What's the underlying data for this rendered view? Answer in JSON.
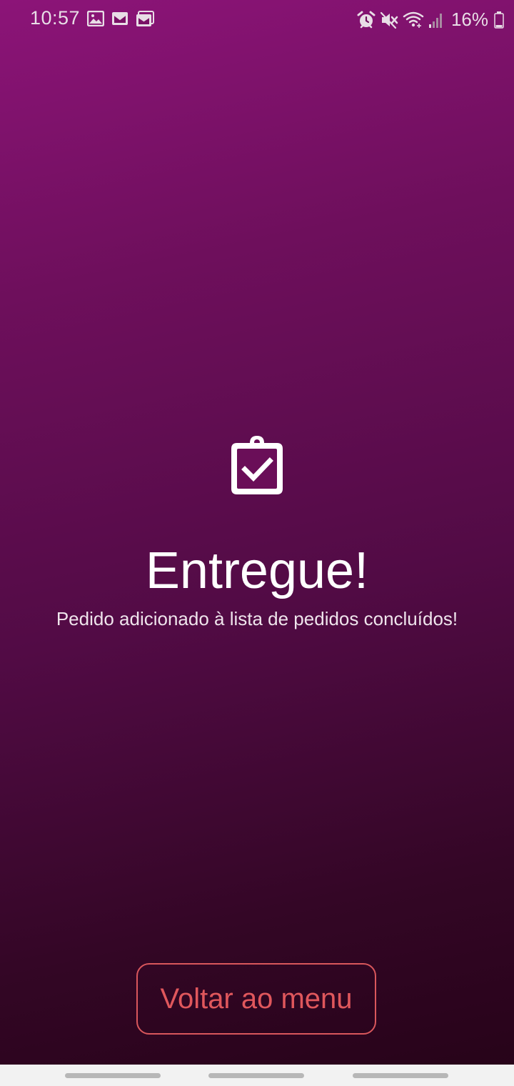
{
  "status_bar": {
    "time": "10:57",
    "battery_percent": "16%",
    "left_icons": [
      "image-icon",
      "mail-icon",
      "mail-stack-icon"
    ],
    "right_icons": [
      "alarm-icon",
      "mute-icon",
      "wifi-icon",
      "signal-icon",
      "battery-icon"
    ]
  },
  "content": {
    "icon": "clipboard-check-icon",
    "title": "Entregue!",
    "subtitle": "Pedido adicionado à lista de pedidos concluídos!"
  },
  "actions": {
    "back_label": "Voltar ao menu"
  },
  "colors": {
    "gradient_top": "#8c1478",
    "gradient_bottom": "#260318",
    "button_accent": "#e0575c",
    "nav_bar": "#f2f2f2"
  },
  "nav_bar": {
    "handles": [
      "recents-handle",
      "home-handle",
      "back-handle"
    ]
  }
}
